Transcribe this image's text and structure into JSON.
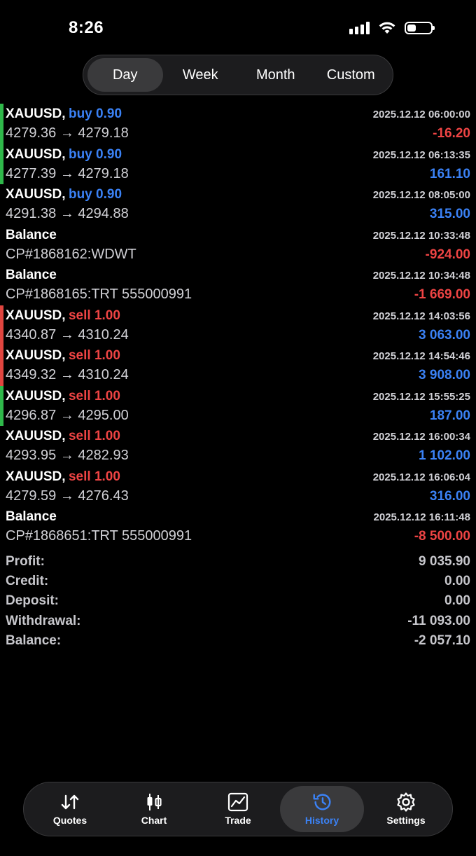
{
  "status": {
    "time": "8:26"
  },
  "periods": [
    {
      "label": "Day",
      "active": true
    },
    {
      "label": "Week",
      "active": false
    },
    {
      "label": "Month",
      "active": false
    },
    {
      "label": "Custom",
      "active": false
    }
  ],
  "deals": [
    {
      "symbol": "XAUUSD,",
      "direction": "buy 0.90",
      "type": "buy",
      "time": "2025.12.12 06:00:00",
      "prices": "4279.36 → 4279.18",
      "profit": "-16.20",
      "profit_sign": "neg",
      "marker": "green"
    },
    {
      "symbol": "XAUUSD,",
      "direction": "buy 0.90",
      "type": "buy",
      "time": "2025.12.12 06:13:35",
      "prices": "4277.39 → 4279.18",
      "profit": "161.10",
      "profit_sign": "pos",
      "marker": "green"
    },
    {
      "symbol": "XAUUSD,",
      "direction": "buy 0.90",
      "type": "buy",
      "time": "2025.12.12 08:05:00",
      "prices": "4291.38 → 4294.88",
      "profit": "315.00",
      "profit_sign": "pos",
      "marker": "none"
    },
    {
      "symbol": "Balance",
      "direction": "",
      "type": "balance",
      "time": "2025.12.12 10:33:48",
      "prices": "CP#1868162:WDWT",
      "profit": "-924.00",
      "profit_sign": "neg",
      "marker": "none"
    },
    {
      "symbol": "Balance",
      "direction": "",
      "type": "balance",
      "time": "2025.12.12 10:34:48",
      "prices": "CP#1868165:TRT 555000991",
      "profit": "-1 669.00",
      "profit_sign": "neg",
      "marker": "none"
    },
    {
      "symbol": "XAUUSD,",
      "direction": "sell 1.00",
      "type": "sell",
      "time": "2025.12.12 14:03:56",
      "prices": "4340.87 → 4310.24",
      "profit": "3 063.00",
      "profit_sign": "pos",
      "marker": "red"
    },
    {
      "symbol": "XAUUSD,",
      "direction": "sell 1.00",
      "type": "sell",
      "time": "2025.12.12 14:54:46",
      "prices": "4349.32 → 4310.24",
      "profit": "3 908.00",
      "profit_sign": "pos",
      "marker": "red"
    },
    {
      "symbol": "XAUUSD,",
      "direction": "sell 1.00",
      "type": "sell",
      "time": "2025.12.12 15:55:25",
      "prices": "4296.87 → 4295.00",
      "profit": "187.00",
      "profit_sign": "pos",
      "marker": "green"
    },
    {
      "symbol": "XAUUSD,",
      "direction": "sell 1.00",
      "type": "sell",
      "time": "2025.12.12 16:00:34",
      "prices": "4293.95 → 4282.93",
      "profit": "1 102.00",
      "profit_sign": "pos",
      "marker": "none"
    },
    {
      "symbol": "XAUUSD,",
      "direction": "sell 1.00",
      "type": "sell",
      "time": "2025.12.12 16:06:04",
      "prices": "4279.59 → 4276.43",
      "profit": "316.00",
      "profit_sign": "pos",
      "marker": "none"
    },
    {
      "symbol": "Balance",
      "direction": "",
      "type": "balance",
      "time": "2025.12.12 16:11:48",
      "prices": "CP#1868651:TRT 555000991",
      "profit": "-8 500.00",
      "profit_sign": "neg",
      "marker": "none"
    }
  ],
  "summary": [
    {
      "label": "Profit:",
      "value": "9 035.90"
    },
    {
      "label": "Credit:",
      "value": "0.00"
    },
    {
      "label": "Deposit:",
      "value": "0.00"
    },
    {
      "label": "Withdrawal:",
      "value": "-11 093.00"
    },
    {
      "label": "Balance:",
      "value": "-2 057.10"
    }
  ],
  "tabs": [
    {
      "label": "Quotes",
      "icon": "quotes-icon",
      "active": false
    },
    {
      "label": "Chart",
      "icon": "chart-icon",
      "active": false
    },
    {
      "label": "Trade",
      "icon": "trade-icon",
      "active": false
    },
    {
      "label": "History",
      "icon": "history-icon",
      "active": true
    },
    {
      "label": "Settings",
      "icon": "settings-icon",
      "active": false
    }
  ],
  "colors": {
    "buy": "#3b82f6",
    "sell": "#ef4444",
    "marker_green": "#2fb84a",
    "marker_red": "#e0453f",
    "active_tab": "#3b82f6"
  }
}
